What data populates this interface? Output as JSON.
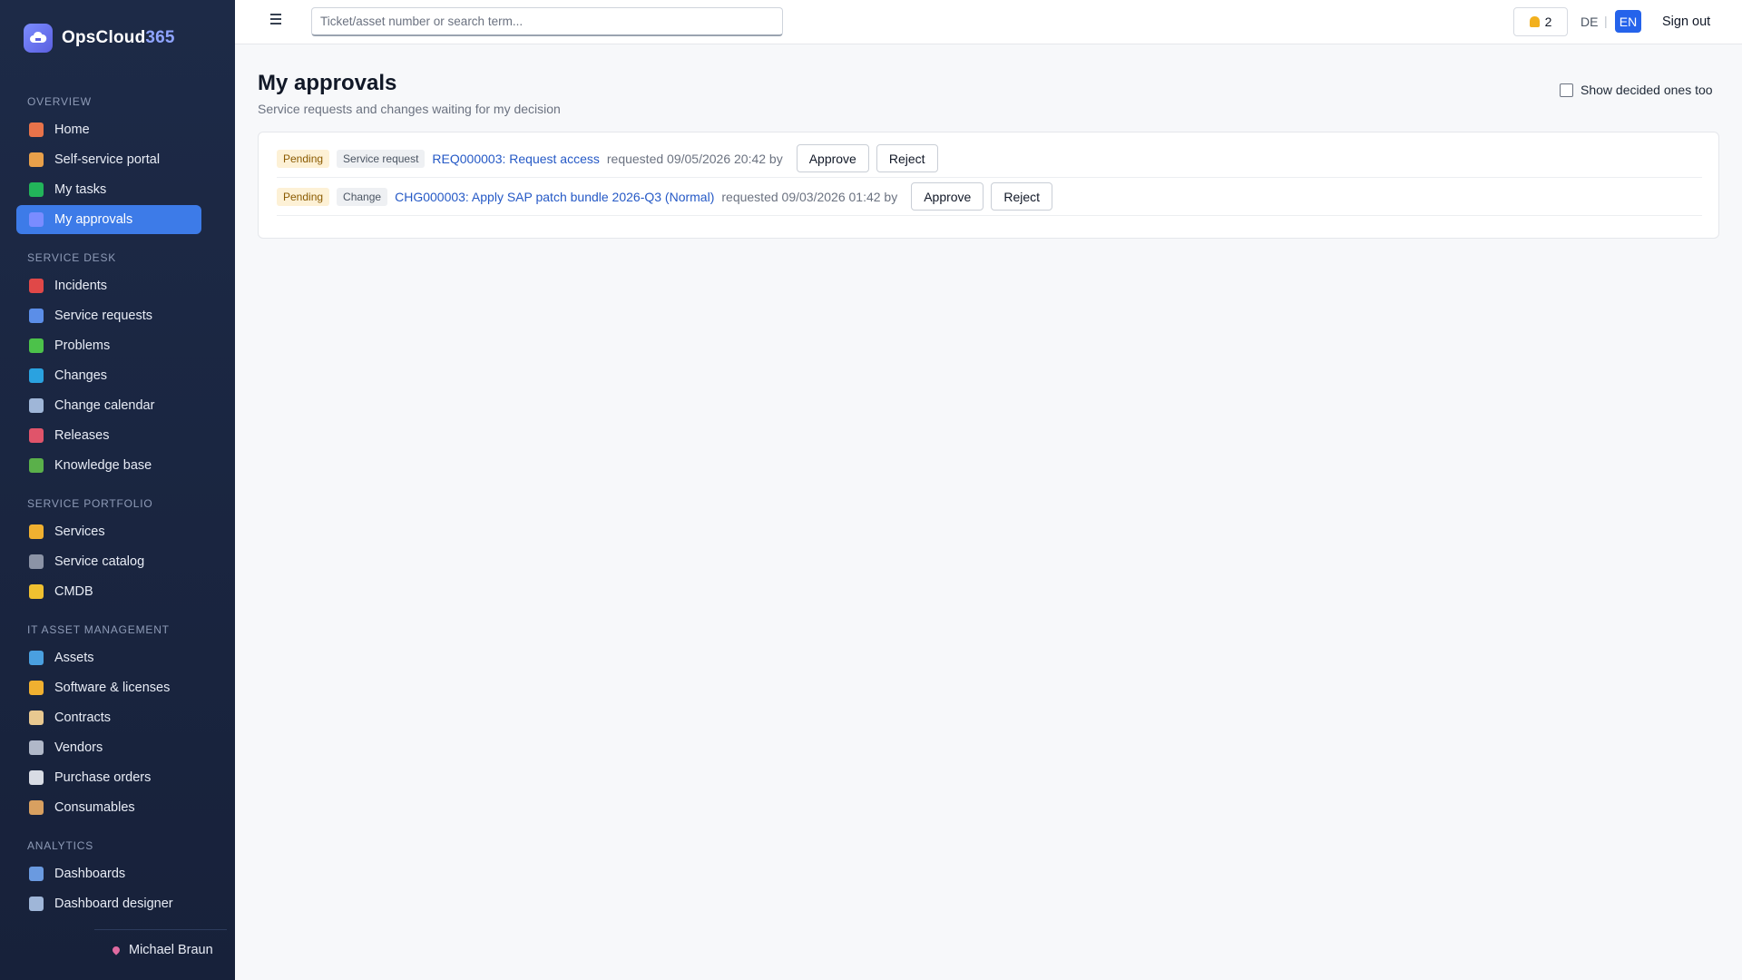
{
  "brand": {
    "name_part1": "OpsCloud",
    "name_part2": "365"
  },
  "sidebar": {
    "sections": [
      {
        "label": "OVERVIEW",
        "items": [
          {
            "label": "Home",
            "icon": "home-icon",
            "color": "#e8734a"
          },
          {
            "label": "Self-service portal",
            "icon": "person-icon",
            "color": "#e8a04a"
          },
          {
            "label": "My tasks",
            "icon": "checkbox-icon",
            "color": "#22b45a"
          },
          {
            "label": "My approvals",
            "icon": "checkmark-icon",
            "color": "#7a8cff",
            "active": true
          }
        ]
      },
      {
        "label": "SERVICE DESK",
        "items": [
          {
            "label": "Incidents",
            "icon": "siren-icon",
            "color": "#e04848"
          },
          {
            "label": "Service requests",
            "icon": "inbox-icon",
            "color": "#5b8ee8"
          },
          {
            "label": "Problems",
            "icon": "puzzle-icon",
            "color": "#4cc24a"
          },
          {
            "label": "Changes",
            "icon": "repeat-icon",
            "color": "#2aa2e0"
          },
          {
            "label": "Change calendar",
            "icon": "calendar-icon",
            "color": "#9fb6d8"
          },
          {
            "label": "Releases",
            "icon": "rocket-icon",
            "color": "#e0546a"
          },
          {
            "label": "Knowledge base",
            "icon": "books-icon",
            "color": "#5ab04a"
          }
        ]
      },
      {
        "label": "SERVICE PORTFOLIO",
        "items": [
          {
            "label": "Services",
            "icon": "bell-service-icon",
            "color": "#f0b030"
          },
          {
            "label": "Service catalog",
            "icon": "catalog-icon",
            "color": "#8b93a6"
          },
          {
            "label": "CMDB",
            "icon": "folder-icon",
            "color": "#f0c030"
          }
        ]
      },
      {
        "label": "IT ASSET MANAGEMENT",
        "items": [
          {
            "label": "Assets",
            "icon": "laptop-icon",
            "color": "#4aa0e0"
          },
          {
            "label": "Software & licenses",
            "icon": "disc-icon",
            "color": "#f0b030"
          },
          {
            "label": "Contracts",
            "icon": "scroll-icon",
            "color": "#e8c890"
          },
          {
            "label": "Vendors",
            "icon": "store-icon",
            "color": "#b0b8c8"
          },
          {
            "label": "Purchase orders",
            "icon": "receipt-icon",
            "color": "#d8dce4"
          },
          {
            "label": "Consumables",
            "icon": "package-icon",
            "color": "#d8a060"
          }
        ]
      },
      {
        "label": "ANALYTICS",
        "items": [
          {
            "label": "Dashboards",
            "icon": "bar-chart-icon",
            "color": "#6a9ae0"
          },
          {
            "label": "Dashboard designer",
            "icon": "grid-icon",
            "color": "#9fb6d8"
          }
        ]
      }
    ],
    "user": "Michael Braun"
  },
  "topbar": {
    "search_placeholder": "Ticket/asset number or search term...",
    "notifications": "2",
    "lang_de": "DE",
    "lang_sep": "|",
    "lang_en": "EN",
    "signout": "Sign out"
  },
  "main": {
    "title": "My approvals",
    "subtitle": "Service requests and changes waiting for my decision",
    "show_decided": "Show decided ones too",
    "approvals": [
      {
        "status": "Pending",
        "type": "Service request",
        "link": "REQ000003: Request access",
        "meta": "requested 09/05/2026 20:42 by",
        "approve": "Approve",
        "reject": "Reject"
      },
      {
        "status": "Pending",
        "type": "Change",
        "link": "CHG000003: Apply SAP patch bundle 2026-Q3 (Normal)",
        "meta": "requested 09/03/2026 01:42 by",
        "approve": "Approve",
        "reject": "Reject"
      }
    ]
  }
}
